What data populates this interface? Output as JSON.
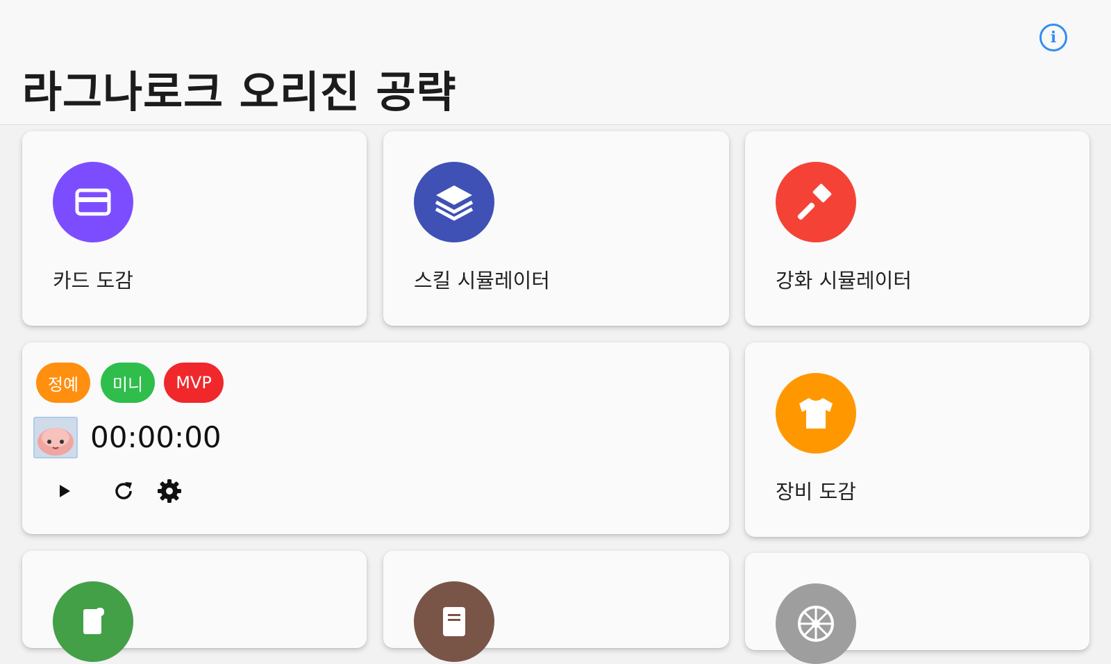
{
  "header": {
    "title": "라그나로크 오리진 공략",
    "info_icon": "info-icon"
  },
  "menu": [
    {
      "label": "카드 도감",
      "icon": "card-icon",
      "color": "#7c4dff"
    },
    {
      "label": "스킬 시뮬레이터",
      "icon": "layers-icon",
      "color": "#3f51b5"
    },
    {
      "label": "강화 시뮬레이터",
      "icon": "hammer-icon",
      "color": "#f44336"
    },
    {
      "label": "장비 도감",
      "icon": "shirt-icon",
      "color": "#ff9800"
    }
  ],
  "timer": {
    "chips": [
      {
        "label": "정예",
        "color": "#ff8f0f"
      },
      {
        "label": "미니",
        "color": "#2fbd4c"
      },
      {
        "label": "MVP",
        "color": "#f0282b"
      }
    ],
    "time": "00:00:00",
    "controls": [
      "play-icon",
      "refresh-icon",
      "settings-icon"
    ]
  },
  "partial_cards": [
    {
      "icon": "scroll-icon",
      "color": "#43a047"
    },
    {
      "icon": "document-icon",
      "color": "#795548"
    },
    {
      "icon": "wheel-icon",
      "color": "#9e9e9e"
    }
  ]
}
